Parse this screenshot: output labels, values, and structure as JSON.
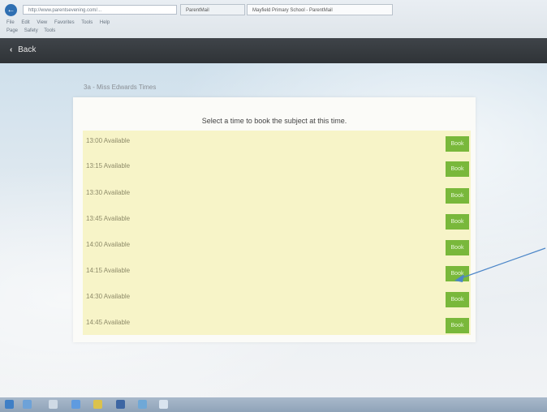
{
  "browser": {
    "address": "http://www.parentsevening.com/...",
    "tabs": [
      "ParentMail",
      "Mayfield Primary School - ParentMail"
    ],
    "menu": [
      "File",
      "Edit",
      "View",
      "Favorites",
      "Tools",
      "Help"
    ],
    "toolbar": [
      "Page",
      "Safety",
      "Tools"
    ]
  },
  "header": {
    "back_label": "Back"
  },
  "panel": {
    "title": "3a - Miss Edwards Times",
    "instruction": "Select a time to book the subject at this time."
  },
  "slots": [
    {
      "label": "13:00 Available",
      "button": "Book"
    },
    {
      "label": "13:15 Available",
      "button": "Book"
    },
    {
      "label": "13:30 Available",
      "button": "Book"
    },
    {
      "label": "13:45 Available",
      "button": "Book"
    },
    {
      "label": "14:00 Available",
      "button": "Book"
    },
    {
      "label": "14:15 Available",
      "button": "Book"
    },
    {
      "label": "14:30 Available",
      "button": "Book"
    },
    {
      "label": "14:45 Available",
      "button": "Book"
    }
  ],
  "colors": {
    "app_header": "#353a3f",
    "slot_background": "#f7f4c8",
    "book_button": "#79b83b",
    "annotation_arrow": "#4c86c8"
  }
}
